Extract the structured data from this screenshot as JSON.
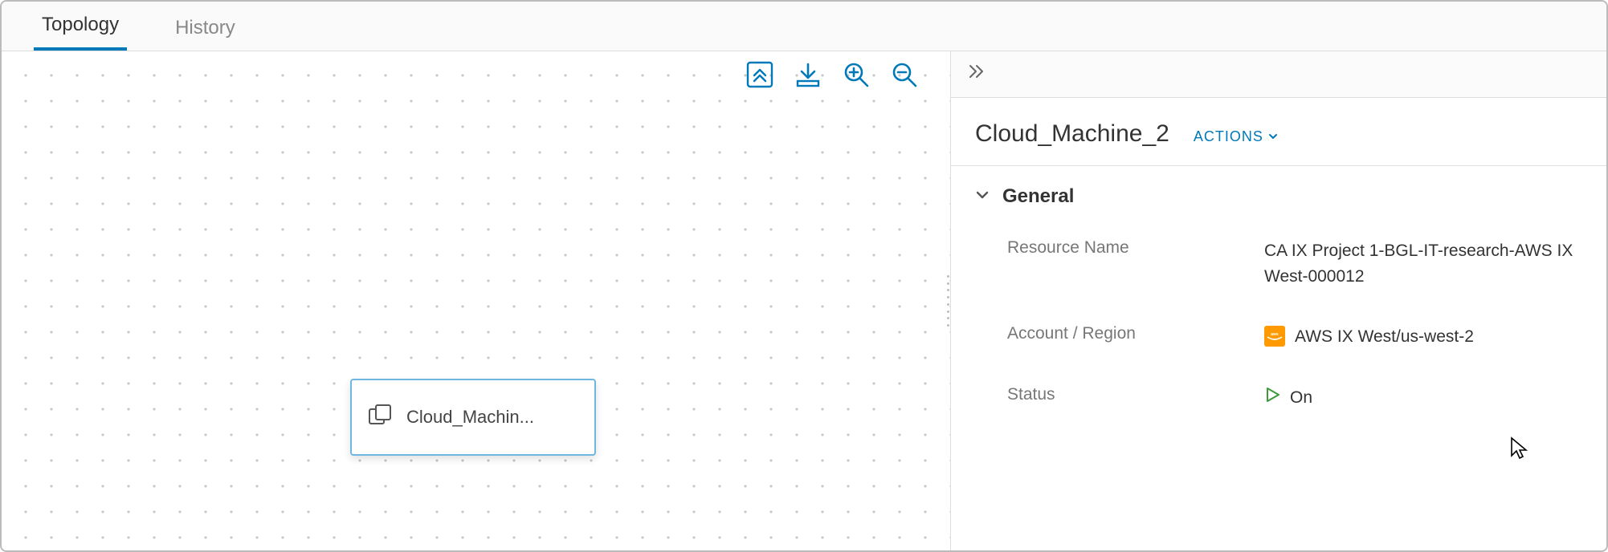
{
  "tabs": {
    "topology": "Topology",
    "history": "History"
  },
  "canvas": {
    "node_label": "Cloud_Machin..."
  },
  "panel": {
    "title": "Cloud_Machine_2",
    "actions_label": "ACTIONS",
    "section_general": "General",
    "fields": {
      "resource_name_label": "Resource Name",
      "resource_name_value": "CA IX Project 1-BGL-IT-research-AWS IX West-000012",
      "account_region_label": "Account / Region",
      "account_region_value": "AWS IX West/us-west-2",
      "status_label": "Status",
      "status_value": "On"
    }
  }
}
